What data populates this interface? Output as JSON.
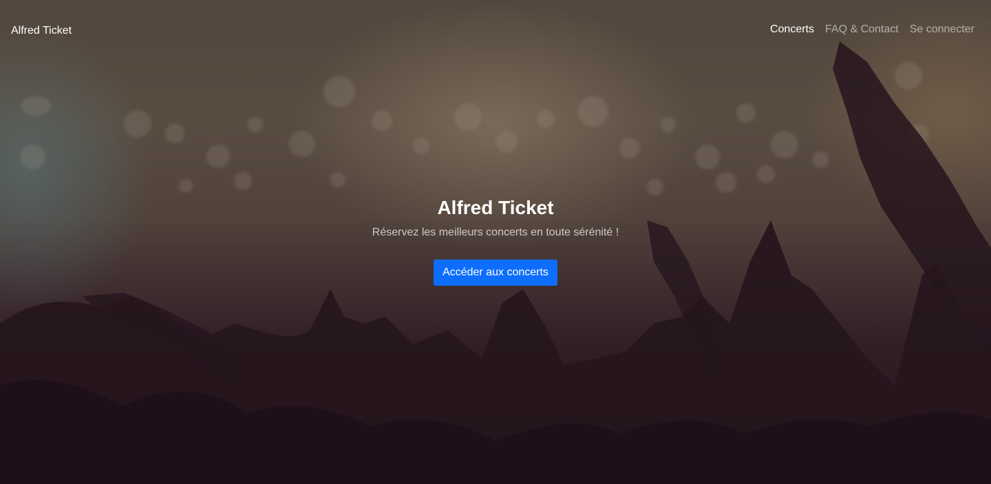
{
  "navbar": {
    "brand": "Alfred Ticket",
    "links": [
      {
        "label": "Concerts",
        "active": true
      },
      {
        "label": "FAQ & Contact",
        "active": false
      },
      {
        "label": "Se connecter",
        "active": false
      }
    ]
  },
  "hero": {
    "title": "Alfred Ticket",
    "subtitle": "Réservez les meilleurs concerts en toute sérénité !",
    "button_label": "Accéder aux concerts"
  },
  "colors": {
    "primary_button": "#0d6efd",
    "text": "#ffffff"
  }
}
